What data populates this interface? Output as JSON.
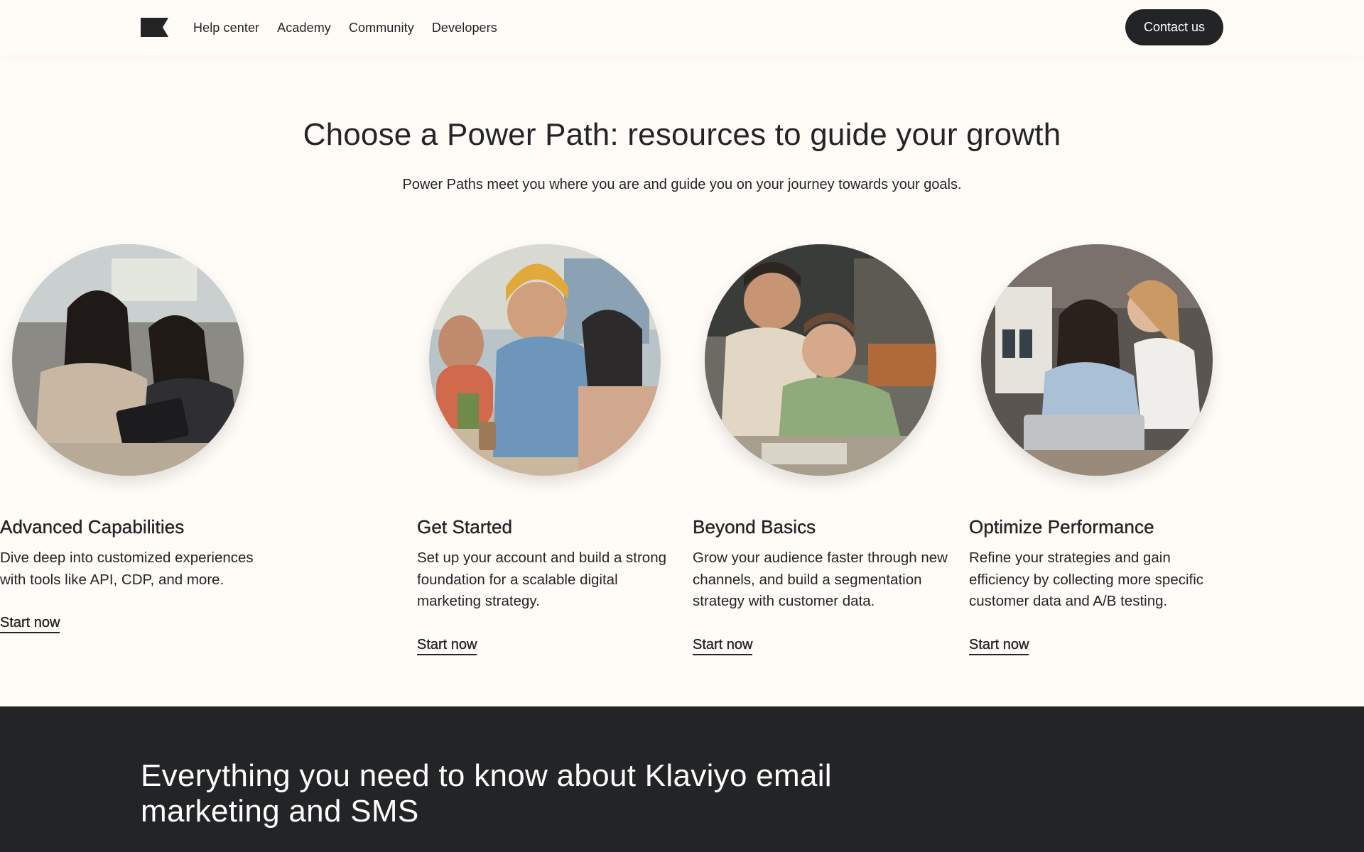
{
  "header": {
    "logo_icon": "klaviyo-flag-logo",
    "nav": [
      {
        "label": "Help center"
      },
      {
        "label": "Academy"
      },
      {
        "label": "Community"
      },
      {
        "label": "Developers"
      }
    ],
    "contact_label": "Contact us"
  },
  "hero": {
    "title": "Choose a Power Path: resources to guide your growth",
    "subtitle": "Power Paths meet you where you are and guide you on your journey towards your goals."
  },
  "paths": [
    {
      "title": "Get Started",
      "description": "Set up your account and build a strong foundation for a scalable digital marketing strategy.",
      "cta": "Start now",
      "photo_icon": "team-collaboration-photo"
    },
    {
      "title": "Beyond Basics",
      "description": "Grow your audience faster through new channels, and build a segmentation strategy with customer data.",
      "cta": "Start now",
      "photo_icon": "team-collaboration-photo"
    },
    {
      "title": "Optimize Performance",
      "description": "Refine your strategies and gain efficiency by collecting more specific customer data and A/B testing.",
      "cta": "Start now",
      "photo_icon": "team-collaboration-photo"
    },
    {
      "title": "Advanced Capabilities",
      "description": "Dive deep into customized experiences with tools like API, CDP, and more.",
      "cta": "Start now",
      "photo_icon": "team-collaboration-photo"
    }
  ],
  "banner": {
    "heading": "Everything you need to know about Klaviyo email marketing and SMS"
  },
  "colors": {
    "background": "#fffcf8",
    "text": "#232426",
    "button": "#232426",
    "dark_band": "#232426"
  }
}
